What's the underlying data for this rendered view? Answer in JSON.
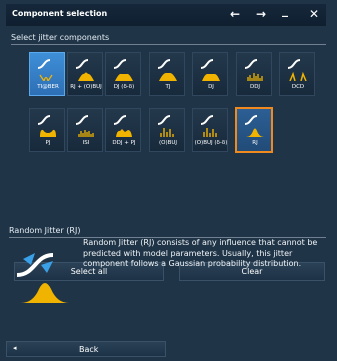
{
  "title": "Component selection",
  "window_controls": [
    "←",
    "→",
    "_",
    "✕"
  ],
  "section1": "Select jitter components",
  "tiles": [
    {
      "label": "TI@BER",
      "icon": "jitter-ti-ber-icon"
    },
    {
      "label": "RJ + (O)BUJ",
      "icon": "jitter-rj-obuj-icon"
    },
    {
      "label": "DJ (δ-δ)",
      "icon": "jitter-dj-dd-icon"
    },
    {
      "label": "TJ",
      "icon": "jitter-tj-icon"
    },
    {
      "label": "DJ",
      "icon": "jitter-dj-icon"
    },
    {
      "label": "DDJ",
      "icon": "jitter-ddj-icon"
    },
    {
      "label": "DCD",
      "icon": "jitter-dcd-icon"
    },
    {
      "label": "PJ",
      "icon": "jitter-pj-icon"
    },
    {
      "label": "ISI",
      "icon": "jitter-isi-icon"
    },
    {
      "label": "DDJ + PJ",
      "icon": "jitter-ddj-pj-icon"
    },
    {
      "label": "(O)BUJ",
      "icon": "jitter-obuj-icon"
    },
    {
      "label": "(O)BUJ (δ-δ)",
      "icon": "jitter-obuj-dd-icon"
    },
    {
      "label": "RJ",
      "icon": "jitter-rj-icon"
    }
  ],
  "buttons": {
    "select_all": "Select all",
    "clear": "Clear"
  },
  "section2": "Random Jitter (RJ)",
  "description": "Random Jitter (RJ) consists of any influence that cannot be predicted with model parameters. Usually, this jitter component follows a Gaussian probability distribution.",
  "back": "Back",
  "colors": {
    "background": "#1f3447",
    "accent": "#f0b400",
    "selection_border": "#f08a1e"
  }
}
